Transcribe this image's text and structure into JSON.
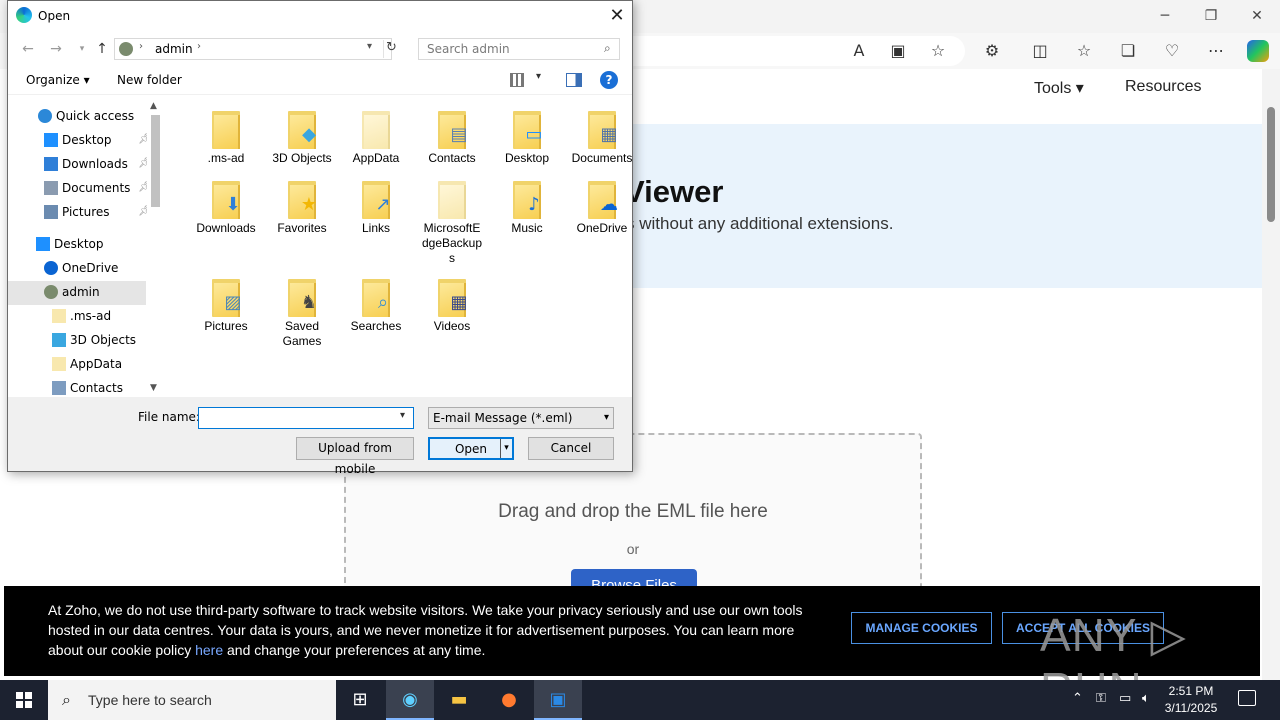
{
  "dialog": {
    "title": "Open",
    "close_label": "✕",
    "address": {
      "path": "admin",
      "chevron": "›"
    },
    "search_placeholder": "Search admin",
    "toolbar": {
      "organize": "Organize ▾",
      "new_folder": "New folder",
      "help": "?"
    },
    "nav_pane": {
      "items": [
        {
          "label": "Quick access",
          "icon": "star-icon",
          "color": "#2b88d8",
          "pinned": false
        },
        {
          "label": "Desktop",
          "icon": "desktop-icon",
          "color": "#1e90ff",
          "pinned": true
        },
        {
          "label": "Downloads",
          "icon": "download-icon",
          "color": "#2f7fd8",
          "pinned": true
        },
        {
          "label": "Documents",
          "icon": "document-icon",
          "color": "#8a9bb0",
          "pinned": true
        },
        {
          "label": "Pictures",
          "icon": "pictures-icon",
          "color": "#6b8bb0",
          "pinned": true
        },
        {
          "label": "Desktop",
          "icon": "desktop-icon",
          "color": "#1e90ff",
          "pinned": false
        },
        {
          "label": "OneDrive",
          "icon": "cloud-icon",
          "color": "#0a64d2",
          "pinned": false
        },
        {
          "label": "admin",
          "icon": "user-icon",
          "color": "#7a8b6d",
          "pinned": false
        },
        {
          "label": ".ms-ad",
          "icon": "folder-icon",
          "color": "#f8e8ae",
          "pinned": false
        },
        {
          "label": "3D Objects",
          "icon": "cube-icon",
          "color": "#3aa7e0",
          "pinned": false
        },
        {
          "label": "AppData",
          "icon": "folder-icon",
          "color": "#f8e8ae",
          "pinned": false
        },
        {
          "label": "Contacts",
          "icon": "contacts-icon",
          "color": "#7d9cc0",
          "pinned": false
        }
      ]
    },
    "files": [
      {
        "label": ".ms-ad",
        "overlay": "",
        "pale": false
      },
      {
        "label": "3D Objects",
        "overlay": "◆",
        "pale": false
      },
      {
        "label": "AppData",
        "overlay": "",
        "pale": true
      },
      {
        "label": "Contacts",
        "overlay": "▤",
        "pale": false
      },
      {
        "label": "Desktop",
        "overlay": "▭",
        "pale": false
      },
      {
        "label": "Documents",
        "overlay": "▦",
        "pale": false
      },
      {
        "label": "Downloads",
        "overlay": "⬇",
        "pale": false
      },
      {
        "label": "Favorites",
        "overlay": "★",
        "pale": false
      },
      {
        "label": "Links",
        "overlay": "↗",
        "pale": false
      },
      {
        "label": "MicrosoftEdgeBackups",
        "overlay": "",
        "pale": true
      },
      {
        "label": "Music",
        "overlay": "♪",
        "pale": false
      },
      {
        "label": "OneDrive",
        "overlay": "☁",
        "pale": false
      },
      {
        "label": "Pictures",
        "overlay": "▨",
        "pale": false
      },
      {
        "label": "Saved Games",
        "overlay": "♞",
        "pale": false
      },
      {
        "label": "Searches",
        "overlay": "⌕",
        "pale": false
      },
      {
        "label": "Videos",
        "overlay": "▦",
        "pale": false
      }
    ],
    "file_name_label": "File name:",
    "file_name_value": "",
    "file_type": "E-mail Message (*.eml)",
    "buttons": {
      "upload": "Upload from mobile",
      "open": "Open",
      "cancel": "Cancel"
    }
  },
  "browser": {
    "nav": {
      "tools": "Tools ▾",
      "resources": "Resources"
    },
    "hero_title": "Viewer",
    "hero_sub": "s without any additional extensions.",
    "drop_text": "Drag and drop the EML file here",
    "drop_or": "or",
    "browse": "Browse Files"
  },
  "cookie": {
    "text_before": "At Zoho, we do not use third-party software to track website visitors. We take your privacy seriously and use our own tools hosted in our data centres. Your data is yours, and we never monetize it for advertisement purposes. You can learn more about our cookie policy ",
    "link": "here",
    "text_after": " and change your preferences at any time.",
    "manage": "MANAGE COOKIES",
    "accept": "ACCEPT ALL COOKIES",
    "watermark": "ANY ▷ RUN"
  },
  "taskbar": {
    "search_placeholder": "Type here to search",
    "time": "2:51 PM",
    "date": "3/11/2025"
  },
  "colors": {
    "accent": "#0078d7",
    "taskbar": "#1c2230",
    "cookie_btn": "#4a90e2"
  }
}
